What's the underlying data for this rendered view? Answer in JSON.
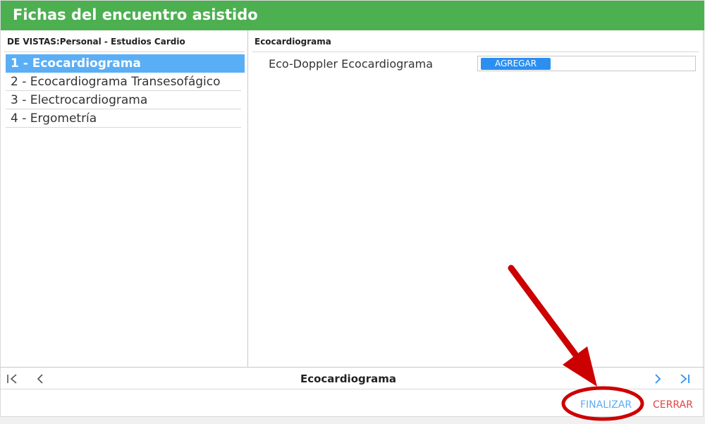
{
  "window": {
    "title": "Fichas del encuentro asistido"
  },
  "left_pane": {
    "header": "DE VISTAS:Personal - Estudios Cardio",
    "items": [
      {
        "label": "1 - Ecocardiograma",
        "selected": true
      },
      {
        "label": "2 - Ecocardiograma Transesofágico",
        "selected": false
      },
      {
        "label": "3 - Electrocardiograma",
        "selected": false
      },
      {
        "label": "4 - Ergometría",
        "selected": false
      }
    ]
  },
  "right_pane": {
    "header": "Ecocardiograma",
    "field": {
      "label": "Eco-Doppler Ecocardiograma",
      "button_label": "AGREGAR"
    }
  },
  "pager": {
    "title": "Ecocardiograma"
  },
  "footer": {
    "finalizar_label": "FINALIZAR",
    "cerrar_label": "CERRAR"
  },
  "colors": {
    "titlebar": "#4caf50",
    "selection": "#5aaef5",
    "primary_button": "#2c8ff0",
    "finalizar": "#5aaef5",
    "cerrar": "#e04343",
    "annotation": "#cc0000"
  }
}
